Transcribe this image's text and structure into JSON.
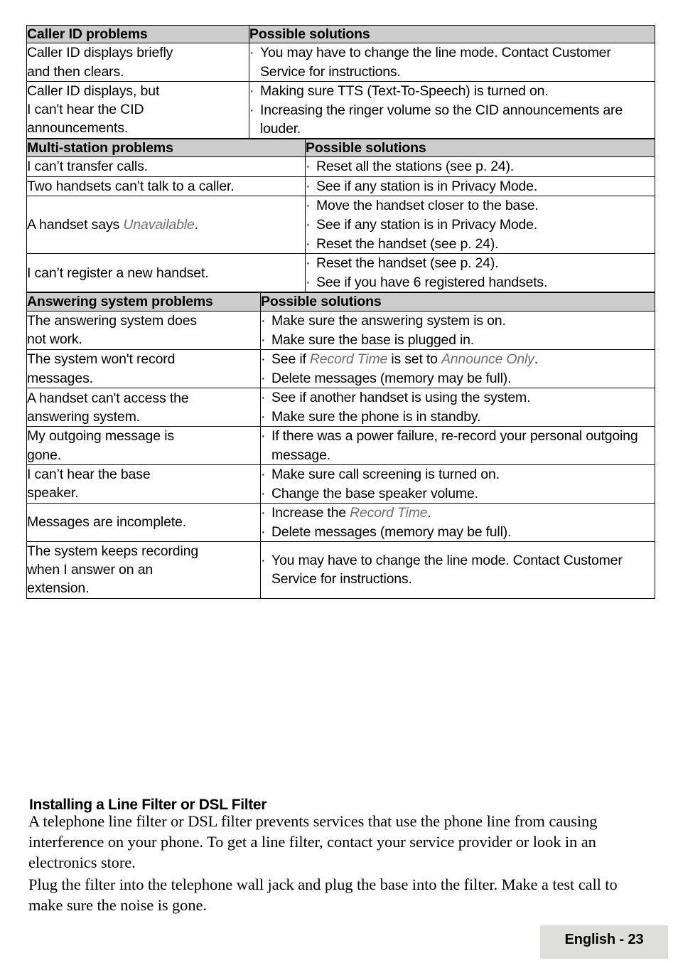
{
  "colors": {
    "header_row_bg": "#cccccc",
    "footer_bg": "#dededc",
    "border": "#000000",
    "emphasis_text": "#6f6f6f"
  },
  "tables": [
    {
      "id": "caller-id-problems",
      "headers": [
        "Caller ID problems",
        "Possible solutions"
      ],
      "rows": [
        {
          "problem_lines": [
            "Caller ID displays briefly",
            "and then clears."
          ],
          "solutions": [
            {
              "segments": [
                {
                  "text": "You may have to change the line mode. Contact Customer Service for instructions.",
                  "style": "normal"
                }
              ]
            }
          ]
        },
        {
          "problem_lines": [
            "Caller ID displays, but",
            "I can't hear the CID",
            "announcements."
          ],
          "solutions": [
            {
              "segments": [
                {
                  "text": "Making sure TTS (Text-To-Speech) is turned on.",
                  "style": "normal"
                }
              ]
            },
            {
              "segments": [
                {
                  "text": "Increasing the ringer volume so the CID announcements are louder.",
                  "style": "normal"
                }
              ]
            }
          ]
        }
      ]
    },
    {
      "id": "multi-station-problems",
      "headers": [
        "Multi-station problems",
        "Possible solutions"
      ],
      "rows": [
        {
          "problem_lines": [
            "I can’t transfer calls."
          ],
          "solutions": [
            {
              "segments": [
                {
                  "text": "Reset all the stations (see p. 24).",
                  "style": "normal"
                }
              ]
            }
          ]
        },
        {
          "problem_lines": [
            "Two handsets can’t talk to a caller."
          ],
          "solutions": [
            {
              "segments": [
                {
                  "text": "See if any station is in Privacy Mode.",
                  "style": "normal"
                }
              ]
            }
          ]
        },
        {
          "problem_lines": [
            "A handset says Unavailable."
          ],
          "problem_segments": [
            {
              "text": "A handset says ",
              "style": "normal"
            },
            {
              "text": "Unavailable",
              "style": "italic"
            },
            {
              "text": ".",
              "style": "normal"
            }
          ],
          "solutions": [
            {
              "segments": [
                {
                  "text": "Move the handset closer to the base.",
                  "style": "normal"
                }
              ]
            },
            {
              "segments": [
                {
                  "text": "See if any station is in Privacy Mode.",
                  "style": "normal"
                }
              ]
            },
            {
              "segments": [
                {
                  "text": "Reset the handset (see p. 24).",
                  "style": "normal"
                }
              ]
            }
          ]
        },
        {
          "problem_lines": [
            "I can’t register a new handset."
          ],
          "solutions": [
            {
              "segments": [
                {
                  "text": "Reset the handset (see p. 24).",
                  "style": "normal"
                }
              ]
            },
            {
              "segments": [
                {
                  "text": "See if you have 6 registered handsets.",
                  "style": "normal"
                }
              ]
            }
          ]
        }
      ]
    },
    {
      "id": "answering-system-problems",
      "headers": [
        "Answering system problems",
        "Possible solutions"
      ],
      "rows": [
        {
          "problem_lines": [
            "The answering system does",
            "not work."
          ],
          "solutions": [
            {
              "segments": [
                {
                  "text": "Make sure the answering system is on.",
                  "style": "normal"
                }
              ]
            },
            {
              "segments": [
                {
                  "text": "Make sure the base is plugged in.",
                  "style": "normal"
                }
              ]
            }
          ]
        },
        {
          "problem_lines": [
            "The system won't record",
            "messages."
          ],
          "solutions": [
            {
              "segments": [
                {
                  "text": "See if ",
                  "style": "normal"
                },
                {
                  "text": "Record Time",
                  "style": "italic"
                },
                {
                  "text": " is set to ",
                  "style": "normal"
                },
                {
                  "text": "Announce Only",
                  "style": "italic"
                },
                {
                  "text": ".",
                  "style": "normal"
                }
              ]
            },
            {
              "segments": [
                {
                  "text": "Delete messages (memory may be full).",
                  "style": "normal"
                }
              ]
            }
          ]
        },
        {
          "problem_lines": [
            "A handset can't access the",
            "answering system."
          ],
          "solutions": [
            {
              "segments": [
                {
                  "text": "See if another handset is using the system.",
                  "style": "normal"
                }
              ]
            },
            {
              "segments": [
                {
                  "text": "Make sure the phone is in standby.",
                  "style": "normal"
                }
              ]
            }
          ]
        },
        {
          "problem_lines": [
            "My outgoing message is",
            "gone."
          ],
          "solutions": [
            {
              "segments": [
                {
                  "text": "If there was a power failure, re-record your personal outgoing message.",
                  "style": "normal"
                }
              ]
            }
          ]
        },
        {
          "problem_lines": [
            "I can’t hear the base",
            "speaker."
          ],
          "solutions": [
            {
              "segments": [
                {
                  "text": "Make sure call screening is turned on.",
                  "style": "normal"
                }
              ]
            },
            {
              "segments": [
                {
                  "text": "Change the base speaker volume.",
                  "style": "normal"
                }
              ]
            }
          ]
        },
        {
          "problem_lines": [
            "Messages are incomplete."
          ],
          "solutions": [
            {
              "segments": [
                {
                  "text": "Increase the ",
                  "style": "normal"
                },
                {
                  "text": "Record Time",
                  "style": "italic"
                },
                {
                  "text": ".",
                  "style": "normal"
                }
              ]
            },
            {
              "segments": [
                {
                  "text": "Delete messages (memory may be full).",
                  "style": "normal"
                }
              ]
            }
          ]
        },
        {
          "problem_lines": [
            "The system keeps recording",
            "when I answer on an",
            "extension."
          ],
          "solutions": [
            {
              "segments": [
                {
                  "text": "You may have to change the line mode. Contact Customer Service for instructions.",
                  "style": "normal"
                }
              ]
            }
          ]
        }
      ]
    }
  ],
  "section": {
    "heading": "Installing a Line Filter or DSL Filter",
    "paragraphs": [
      "A telephone line filter or DSL filter prevents services that use the phone line from causing interference on your phone. To get a line filter, contact your service provider or look in an electronics store.",
      "Plug the filter into the telephone wall jack and plug the base into the filter. Make a test call to make sure the noise is gone."
    ]
  },
  "footer": {
    "page_label": "English - 23"
  },
  "bullet_glyph": "·"
}
